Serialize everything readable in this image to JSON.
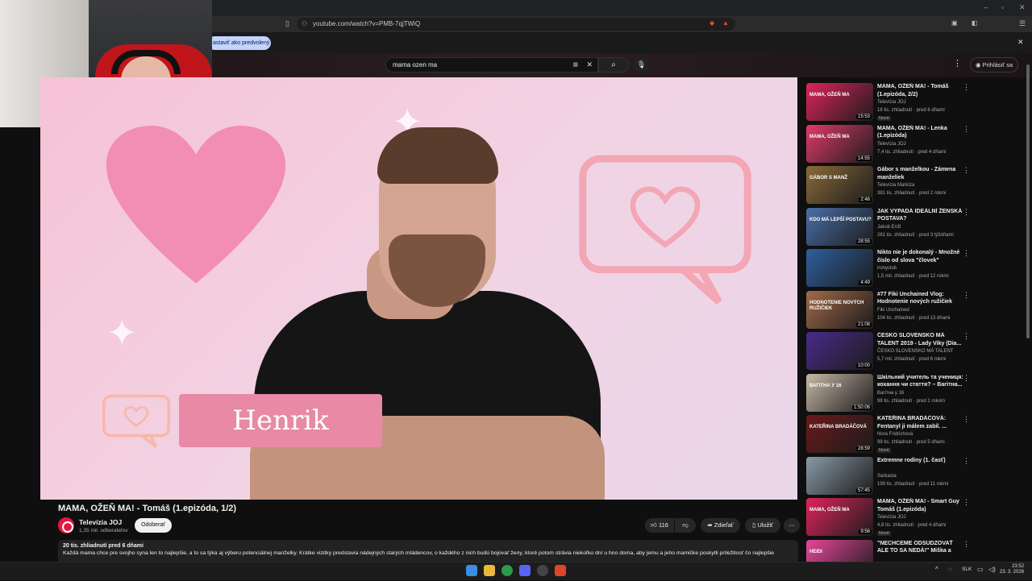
{
  "browser": {
    "url": "youtube.com/watch?v=PMB-7qjTWiQ",
    "infobar_button": "astaviť ako predvolený",
    "close_infobar": "✕"
  },
  "youtube": {
    "search_value": "mama ozen ma",
    "signin_label": "Prihlásiť sa"
  },
  "video": {
    "overlay_name": "Henrik",
    "title": "MAMA, OŽEŇ MA! - Tomáš (1.epizóda, 1/2)",
    "channel_name": "Televízia JOJ",
    "channel_subs": "1,35 mil. odberateľov",
    "subscribe_label": "Odoberať",
    "likes": "116",
    "share_label": "Zdieľať",
    "save_label": "Uložiť",
    "desc_stats": "20 tis. zhliadnutí  pred 6 dňami",
    "desc_text": "Každá mama chce pre svojho syna len to najlepšie, a to sa týka aj výberu potenciálnej manželky. Krátke vizitky predstavia nádejných starých mládencov, o každého z nich budú bojovať ženy, ktoré potom strávia niekoľko dní u hno doma, aby jemu a jeho mamičke poskytli príležitosť čo najlepšie"
  },
  "recommendations": [
    {
      "title": "MAMA, OŽEŇ MA! - Tomáš (1.epizóda, 2/2)",
      "channel": "Televízia JOJ",
      "stats": "18 tis. zhliadnutí · pred 6 dňami",
      "badge": "Nové",
      "duration": "15:53",
      "thumb_color": "#e0245e",
      "thumb_label": "MAMA, OŽEŇ MA"
    },
    {
      "title": "MAMA, OŽEŇ MA! - Lenka (1.epizóda)",
      "channel": "Televízia JOJ",
      "stats": "7,4 tis. zhliadnutí · pred 4 dňami",
      "badge": "",
      "duration": "14:55",
      "thumb_color": "#e23a6a",
      "thumb_label": "MAMA, OŽEŇ MA"
    },
    {
      "title": "Gábor s manželkou - Zámena manželiek",
      "channel": "Televízia Markíza",
      "stats": "381 tis. zhliadnutí · pred 2 rokmi",
      "badge": "",
      "duration": "2:46",
      "thumb_color": "#8a6a3a",
      "thumb_label": "GÁBOR S MANŽ"
    },
    {
      "title": "JAK VYPADÁ IDEÁLNÍ ŽENSKÁ POSTAVA?",
      "channel": "Jakub Enžl",
      "stats": "261 tis. zhliadnutí · pred 3 týždňami",
      "badge": "",
      "duration": "28:55",
      "thumb_color": "#4a6fa8",
      "thumb_label": "KDO MÁ LEPŠÍ POSTAVU?"
    },
    {
      "title": "Nikto nie je dokonalý - Množné číslo od slova \"človek\"",
      "channel": "ironyclub",
      "stats": "1,5 mil. zhliadnutí · pred 12 rokmi",
      "badge": "",
      "duration": "4:49",
      "thumb_color": "#2f5fa0",
      "thumb_label": ""
    },
    {
      "title": "#77 Fiki Unchained Vlog: Hodnotenie nových ružičiek",
      "channel": "Fiki Unchained",
      "stats": "104 tis. zhliadnutí · pred 13 dňami",
      "badge": "",
      "duration": "21:08",
      "thumb_color": "#a26a4a",
      "thumb_label": "HODNOTENIE NOVÝCH RUŽIČIEK"
    },
    {
      "title": "ČESKO SLOVENSKO MÁ TALENT 2019 - Lady Viky (Dia...",
      "channel": "ČESKO SLOVENSKO MÁ TALENT",
      "stats": "5,7 mil. zhliadnutí · pred 6 rokmi",
      "badge": "",
      "duration": "10:00",
      "thumb_color": "#4a2a8a",
      "thumb_label": ""
    },
    {
      "title": "Шкільний учитель та учениця: кохання чи стаття? – Вагітна...",
      "channel": "Вагітна у 16",
      "stats": "98 tis. zhliadnutí · pred 1 rokom",
      "badge": "",
      "duration": "1:50:06",
      "thumb_color": "#c8b8a8",
      "thumb_label": "ВАГІТНА У 16"
    },
    {
      "title": "KATEŘINA BRADÁČOVÁ: Fentanyl ji málem zabil. ...",
      "channel": "Nora Fridrichová",
      "stats": "98 tis. zhliadnutí · pred 5 dňami",
      "badge": "Nové",
      "duration": "28:59",
      "thumb_color": "#6a1a1a",
      "thumb_label": "KATEŘINA BRADÁČOVÁ"
    },
    {
      "title": "Extremne rodiny (1. časť)",
      "channel": "Sarkasta",
      "stats": "199 tis. zhliadnutí · pred 11 rokmi",
      "badge": "",
      "duration": "57:45",
      "thumb_color": "#8a9aa8",
      "thumb_label": ""
    },
    {
      "title": "MAMA, OŽEŇ MA! - Smart Guy Tomáš (1.epizóda)",
      "channel": "Televízia JOJ",
      "stats": "4,8 tis. zhliadnutí · pred 4 dňami",
      "badge": "Nové",
      "duration": "9:56",
      "thumb_color": "#e0245e",
      "thumb_label": "MAMA, OŽEŇ MA"
    },
    {
      "title": "\"NECHCEME ODSUDZOVAŤ ALE TO SA NEDÁ!\" Miška a Heidi z ...",
      "channel": "",
      "stats": "",
      "badge": "",
      "duration": "",
      "thumb_color": "#e8469a",
      "thumb_label": "HEIDI"
    }
  ],
  "taskbar": {
    "lang": "SLK",
    "time": "23:52",
    "date": "23. 3. 2026"
  },
  "colors": {
    "accent": "#e5173f",
    "bg": "#0f0f0f"
  }
}
